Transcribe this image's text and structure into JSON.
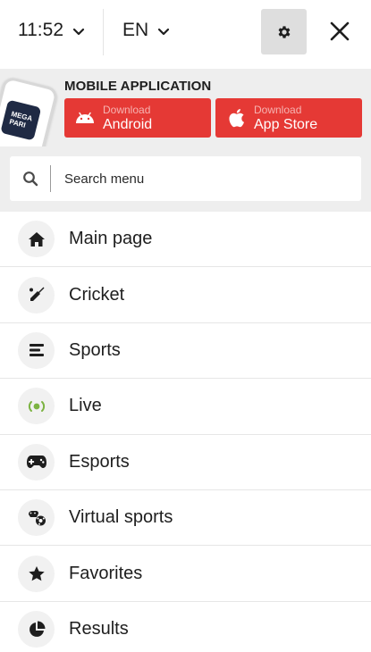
{
  "header": {
    "time": "11:52",
    "language": "EN",
    "icons": [
      "chevron-down-icon",
      "gear-icon",
      "close-icon"
    ]
  },
  "app_banner": {
    "title": "MOBILE APPLICATION",
    "logo_text": [
      "MEGA",
      "PARI"
    ],
    "android": {
      "small": "Download",
      "big": "Android",
      "icon": "android-icon"
    },
    "apple": {
      "small": "Download",
      "big": "App Store",
      "icon": "apple-icon"
    },
    "accent_color": "#e53935"
  },
  "search": {
    "placeholder": "Search menu",
    "icon": "search-icon"
  },
  "menu": {
    "items": [
      {
        "label": "Main page",
        "icon": "home-icon"
      },
      {
        "label": "Cricket",
        "icon": "cricket-bat-icon"
      },
      {
        "label": "Sports",
        "icon": "sports-list-icon"
      },
      {
        "label": "Live",
        "icon": "live-icon"
      },
      {
        "label": "Esports",
        "icon": "gamepad-icon"
      },
      {
        "label": "Virtual sports",
        "icon": "virtual-sports-icon"
      },
      {
        "label": "Favorites",
        "icon": "star-icon"
      },
      {
        "label": "Results",
        "icon": "pie-chart-icon"
      }
    ],
    "live_color": "#7cb342"
  }
}
